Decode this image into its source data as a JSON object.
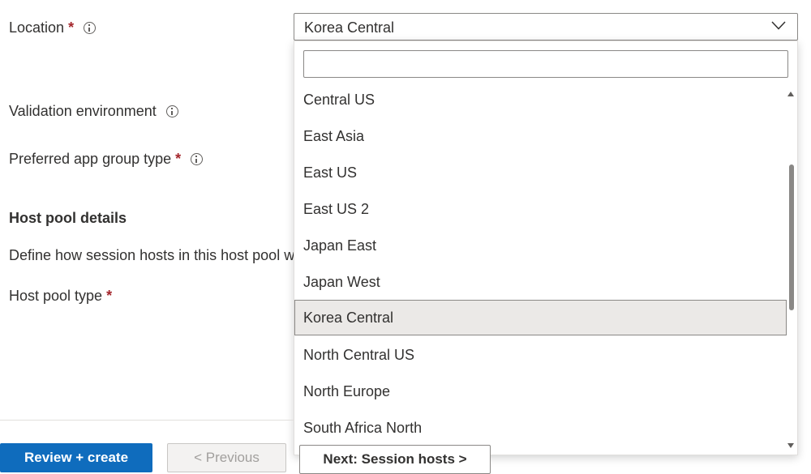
{
  "form": {
    "location_label": "Location",
    "validation_label": "Validation environment",
    "app_group_label": "Preferred app group type",
    "required_mark": "*",
    "host_pool_section": "Host pool details",
    "host_pool_description": "Define how session hosts in this host pool w",
    "host_pool_type_label": "Host pool type"
  },
  "location_select": {
    "selected_value": "Korea Central",
    "filter_value": "",
    "options": [
      "Central US",
      "East Asia",
      "East US",
      "East US 2",
      "Japan East",
      "Japan West",
      "Korea Central",
      "North Central US",
      "North Europe",
      "South Africa North"
    ],
    "selected_index": 6
  },
  "footer": {
    "review_create_label": "Review + create",
    "previous_label": "< Previous",
    "next_label": "Next: Session hosts >"
  },
  "colors": {
    "primary": "#0f6cbd",
    "required": "#a4262c",
    "selected_option_bg": "#ebe9e7"
  }
}
